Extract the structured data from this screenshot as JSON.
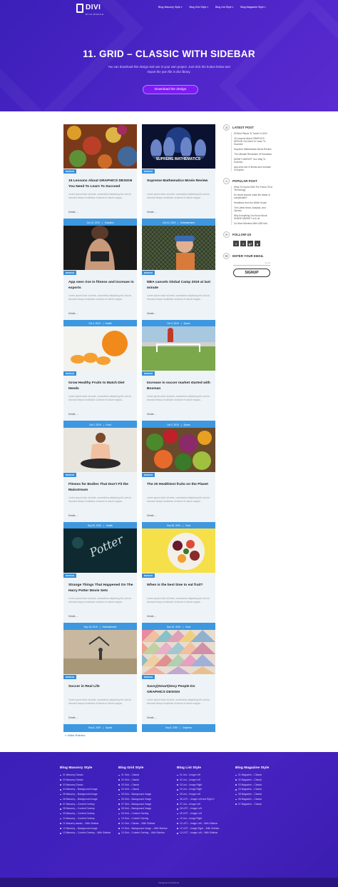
{
  "header": {
    "logo": {
      "name": "DIVI",
      "tagline": "BLOG MODULE"
    },
    "nav": [
      {
        "label": "Blog Masonry Style"
      },
      {
        "label": "Blog Grid Style"
      },
      {
        "label": "Blog List Style"
      },
      {
        "label": "Blog Magazine Style"
      }
    ]
  },
  "hero": {
    "title": "11. GRID – CLASSIC WITH SIDEBAR",
    "description": "You can download this design and use in your own project. Just click the button below and import the json file in divi library.",
    "button": "Download the design"
  },
  "posts": [
    {
      "tag": "DESIGN",
      "title": "15 Lessons About GRAPHICS DESIGN You Need To Learn To Succeed",
      "excerpt": "Lorem ipsum dolor sit amet, consectetur adipiscing elit, sed do eiusmod tempor incididunt ut labore et dolore magna...",
      "read_more": "Details",
      "date": "Oct 12, 2019",
      "category": "Graphics"
    },
    {
      "tag": "DESIGN",
      "title": "Supreme Mathematics Movie Review",
      "excerpt": "Lorem ipsum dolor sit amet, consectetur adipiscing elit, sed do eiusmod tempor incididunt ut labore et dolore magna...",
      "read_more": "Details",
      "date": "Oct 10, 2019",
      "category": "Entertainment"
    },
    {
      "tag": "DESIGN",
      "title": "App sees rise in fitness and increase in exports",
      "excerpt": "Lorem ipsum dolor sit amet, consectetur adipiscing elit, sed do eiusmod tempor incididunt ut labore et dolore magna...",
      "read_more": "Details",
      "date": "Oct 3, 2019",
      "category": "Health"
    },
    {
      "tag": "DESIGN",
      "title": "NBA cancels Global Camp 2019 at last minute",
      "excerpt": "Lorem ipsum dolor sit amet, consectetur adipiscing elit, sed do eiusmod tempor incididunt ut labore et dolore magna...",
      "read_more": "Details",
      "date": "Oct 3, 2019",
      "category": "Sports"
    },
    {
      "tag": "DESIGN",
      "title": "Grow Healthy Fruits to Match Diet Needs",
      "excerpt": "Lorem ipsum dolor sit amet, consectetur adipiscing elit, sed do eiusmod tempor incididunt ut labore et dolore magna...",
      "read_more": "Details",
      "date": "Oct 2, 2019",
      "category": "Food"
    },
    {
      "tag": "DESIGN",
      "title": "Increase in soccer market started with Bosman",
      "excerpt": "Lorem ipsum dolor sit amet, consectetur adipiscing elit, sed do eiusmod tempor incididunt ut labore et dolore magna...",
      "read_more": "Details",
      "date": "Oct 2, 2019",
      "category": "Sports"
    },
    {
      "tag": "DESIGN",
      "title": "Fitness for Bodies That Don't Fit the Mainstream",
      "excerpt": "Lorem ipsum dolor sit amet, consectetur adipiscing elit, sed do eiusmod tempor incididunt ut labore et dolore magna...",
      "read_more": "Details",
      "date": "Sep 30, 2019",
      "category": "Health"
    },
    {
      "tag": "DESIGN",
      "title": "The 20 Healthiest fruits on the Planet",
      "excerpt": "Lorem ipsum dolor sit amet, consectetur adipiscing elit, sed do eiusmod tempor incididunt ut labore et dolore magna...",
      "read_more": "Details",
      "date": "Sep 28, 2019",
      "category": "Food"
    },
    {
      "tag": "DESIGN",
      "title": "Strange Things That Happened On The Harry Potter Movie Sets",
      "excerpt": "Lorem ipsum dolor sit amet, consectetur adipiscing elit, sed do eiusmod tempor incididunt ut labore et dolore magna...",
      "read_more": "Details",
      "date": "Sep 18, 2019",
      "category": "Entertainment"
    },
    {
      "tag": "DESIGN",
      "title": "When is the best time to eat fruit?",
      "excerpt": "Lorem ipsum dolor sit amet, consectetur adipiscing elit, sed do eiusmod tempor incididunt ut labore et dolore magna...",
      "read_more": "Details",
      "date": "Sep 15, 2019",
      "category": "Food"
    },
    {
      "tag": "DESIGN",
      "title": "Soccer in Real Life",
      "excerpt": "Lorem ipsum dolor sit amet, consectetur adipiscing elit, sed do eiusmod tempor incididunt ut labore et dolore magna...",
      "read_more": "Details",
      "date": "Sep 8, 2019",
      "category": "Sports"
    },
    {
      "tag": "DESIGN",
      "title": "Savvy|Smart|Sexy People Do GRAPHICS DESIGN",
      "excerpt": "Lorem ipsum dolor sit amet, consectetur adipiscing elit, sed do eiusmod tempor incididunt ut labore et dolore magna...",
      "read_more": "Details",
      "date": "Sep 5, 2019",
      "category": "Graphics"
    }
  ],
  "older_entries": "« Older Entries",
  "sidebar": {
    "latest": {
      "title": "LATEST POST",
      "items": [
        "50 Best Places To Travel In 2020",
        "15 Lessons About GRAPHICS DESIGN You Need To Learn To Succeed",
        "Supreme Mathematics Movie Review",
        "The Ultimate Revelation Of Education",
        "MONEY MARKET Your Way To Success",
        "App sees rise in fitness and increase in exports"
      ]
    },
    "popular": {
      "title": "POPULAR POST",
      "items": [
        "What To Expect With The Future Of AI Technology",
        "Do smart phones make life easier or complicated?",
        "Headlines from the White House",
        "The Latest News, Analysis, and Opinion",
        "Why Everything You Know About SHARE MARKET Is A Lie",
        "Go More Wireless With USB Hub"
      ]
    },
    "follow": {
      "title": "FOLLOW US",
      "icons": [
        "f",
        "t",
        "g+",
        "p"
      ]
    },
    "email": {
      "title": "ENTER YOUR EMAIL",
      "placeholder": "Email",
      "button": "SIGNUP"
    }
  },
  "footer": {
    "columns": [
      {
        "title": "Blog Masonry Style",
        "items": [
          "01 Masonry Classic",
          "02 Masonry Classic",
          "03 Masonry Classic",
          "04 Masonry – Background Image",
          "05 Masonry – Background Image",
          "06 Masonry – Background Image",
          "07 Masonry – Content Overlay",
          "08 Masonry – Content Overlay",
          "09 Masonry – Content Overlay",
          "10 Masonry – Content Overlay",
          "11 Masonry classic – With Sidebar",
          "12 Masonry – Background Image",
          "13 Masonry – Content Overlay – With Sidebar"
        ]
      },
      {
        "title": "Blog Grid Style",
        "items": [
          "01 Grid – Classic",
          "02 Grid – Classic",
          "03 Grid – Classic",
          "04 Grid – Classic",
          "05 Grid – Background Image",
          "06 Grid – Background Image",
          "07 Grid – Background Image",
          "08 Grid – Background Image",
          "09 Grid – Content Overlay",
          "10 Grid – Content Overlay",
          "11 Grid – Classic – With Sidebar",
          "12 Grid – Background Image – With Sidebar",
          "13 Grid – Content Overlay – With Sidebar"
        ]
      },
      {
        "title": "Blog List Style",
        "items": [
          "01 List – Image Left",
          "02 List – Image Left",
          "03 List – Image Right",
          "04 List – Image Right",
          "05 List – Image Left",
          "06 LIST – Image Left and Right 2",
          "07 List – Image Left",
          "08 LIST – Image Left",
          "09 LIST – Image Left",
          "10 List – Image Right",
          "11 LIST – Image Left – With Sidebar",
          "12 LIST – Image Right – With Sidebar",
          "13 LIST – Image Left – With Sidebar"
        ]
      },
      {
        "title": "Blog Magazine Style",
        "items": [
          "01 Magazine – Classic",
          "02 Magazine – Classic",
          "03 Magazine – Classic",
          "04 Magazine – Classic",
          "05 Magazine – Classic",
          "06 Magazine – Classic",
          "07 Magazine – Classic"
        ]
      }
    ],
    "copyright": "Designed by Divilover"
  }
}
